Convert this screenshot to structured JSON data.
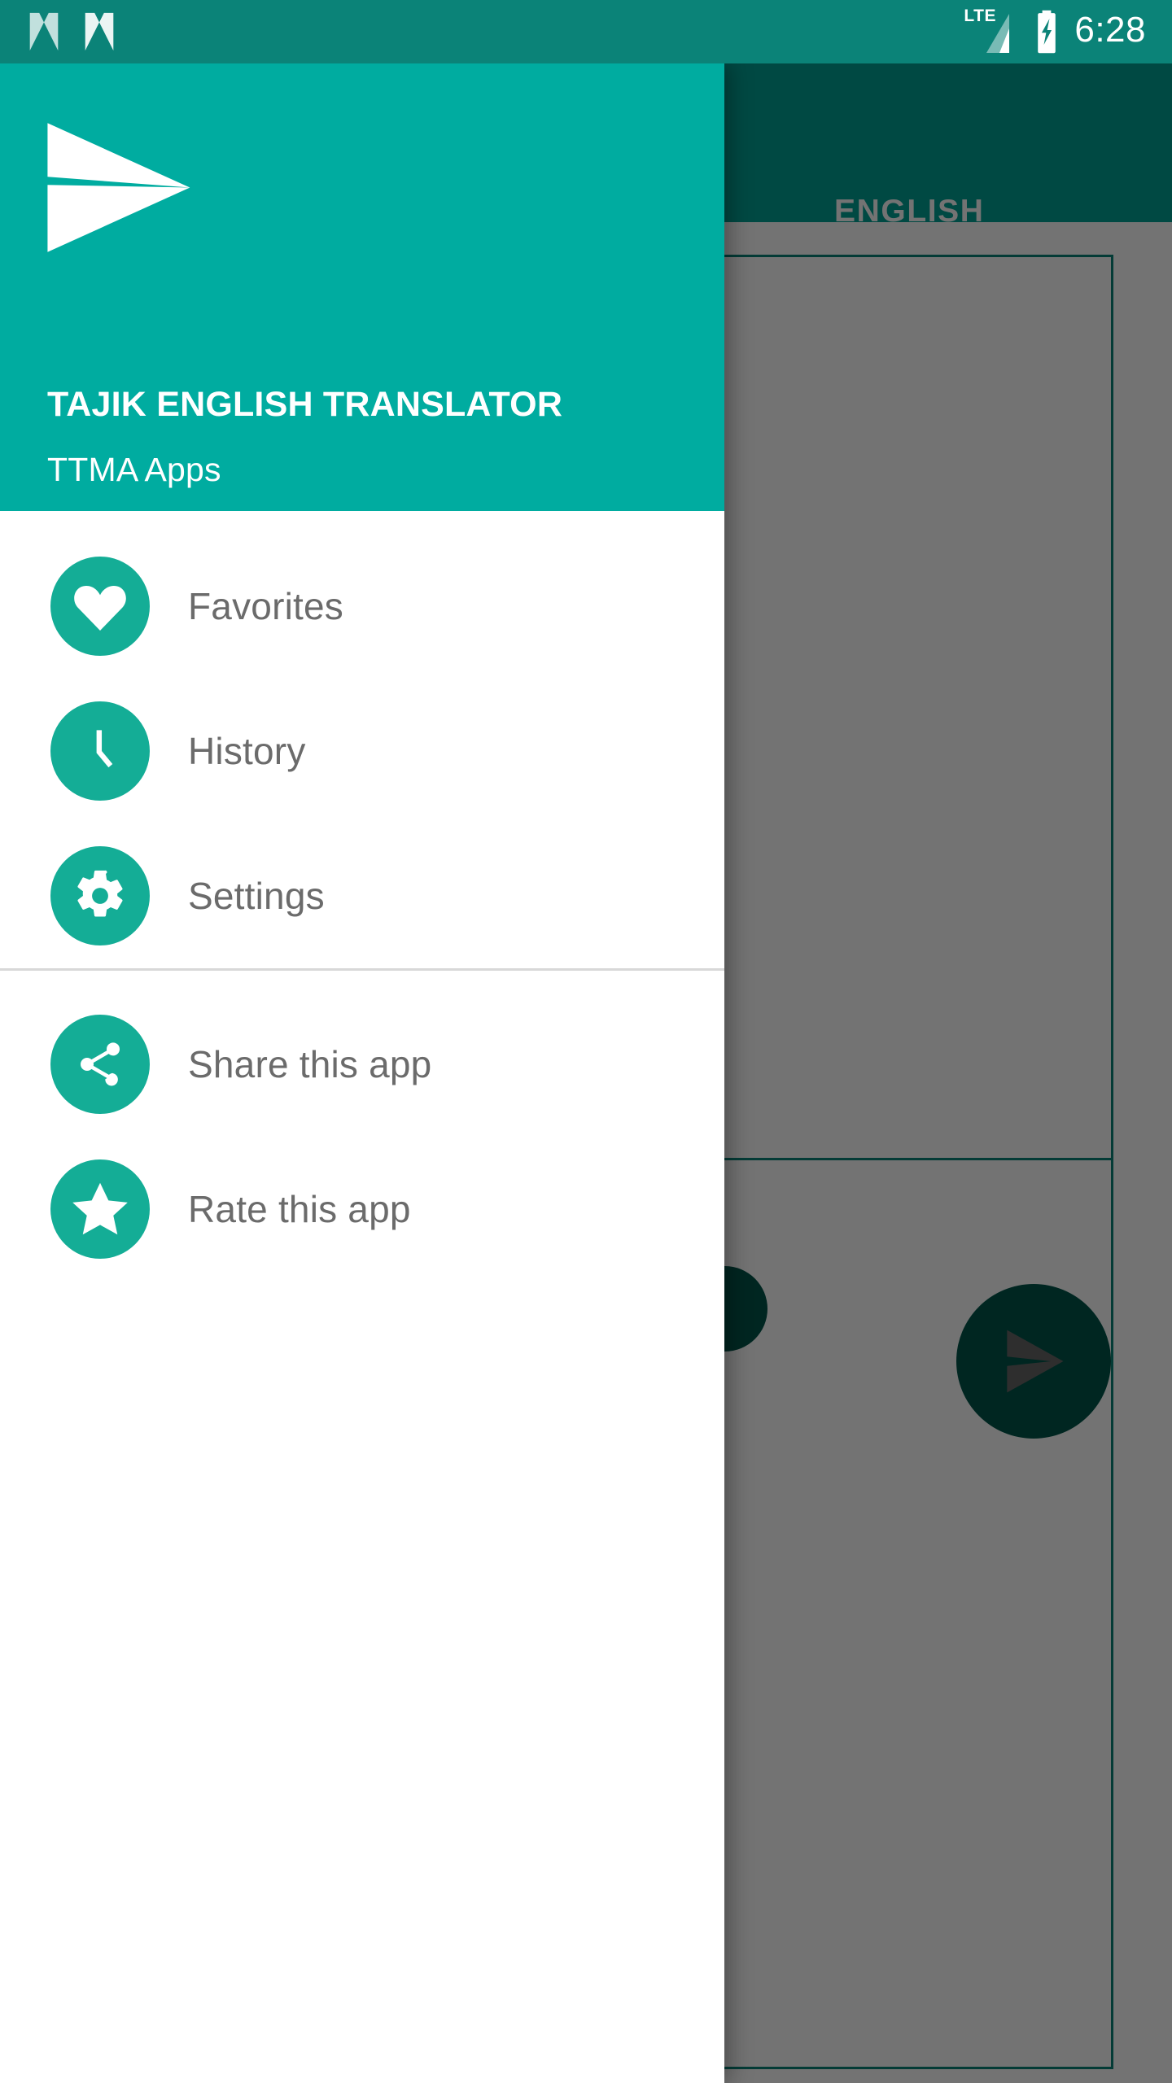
{
  "status_bar": {
    "notification_icons": [
      "n-logo-icon",
      "n-logo-icon"
    ],
    "network_label": "LTE",
    "signal_icon": "signal-bars-icon",
    "battery_icon": "battery-charging-icon",
    "time": "6:28"
  },
  "background_app": {
    "toolbar": {
      "language_label": "ENGLISH"
    },
    "fab": {
      "icon": "send-icon"
    },
    "mini_fab": {
      "icon": "circle-action-icon"
    }
  },
  "drawer": {
    "header": {
      "logo_icon": "send-plane-logo",
      "title": "TAJIK ENGLISH TRANSLATOR",
      "subtitle": "TTMA Apps"
    },
    "groups": [
      {
        "items": [
          {
            "label": "Favorites",
            "icon": "heart-icon",
            "name": "favorites"
          },
          {
            "label": "History",
            "icon": "clock-icon",
            "name": "history"
          },
          {
            "label": "Settings",
            "icon": "gear-icon",
            "name": "settings"
          }
        ]
      },
      {
        "items": [
          {
            "label": "Share this app",
            "icon": "share-icon",
            "name": "share-this-app"
          },
          {
            "label": "Rate this app",
            "icon": "star-icon",
            "name": "rate-this-app"
          }
        ]
      }
    ]
  },
  "colors": {
    "status_bar": "#0b8378",
    "drawer_header": "#00aca0",
    "accent": "#14ad96",
    "toolbar": "#00a294",
    "fab": "#00564b",
    "label_text": "#6b6b6b",
    "divider": "#d8d8d8",
    "scrim": "rgba(0,0,0,0.55)"
  }
}
